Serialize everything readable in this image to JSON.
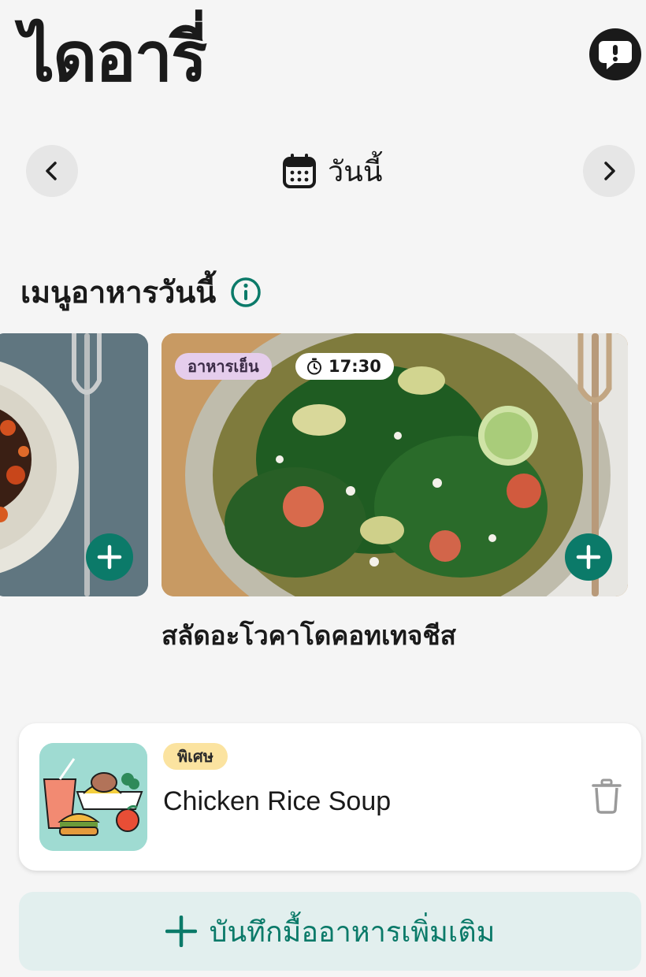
{
  "header": {
    "title": "ไดอารี่",
    "feedback_icon": "feedback-exclamation-icon"
  },
  "date_nav": {
    "label": "วันนี้",
    "prev_icon": "chevron-left-icon",
    "next_icon": "chevron-right-icon",
    "calendar_icon": "calendar-icon"
  },
  "menu": {
    "title": "เมนูอาหารวันนี้",
    "info_icon": "info-icon",
    "cards": [
      {
        "kind": "partial-previous-card"
      },
      {
        "meal_type": "อาหารเย็น",
        "time": "17:30",
        "name": "สลัดอะโวคาโดคอทเทจชีส"
      }
    ]
  },
  "entry": {
    "tag": "พิเศษ",
    "name": "Chicken Rice Soup",
    "delete_icon": "trash-icon"
  },
  "add_more": {
    "label": "บันทึกมื้ออาหารเพิ่มเติม",
    "icon": "plus-icon"
  },
  "colors": {
    "accent": "#0b7a69",
    "background": "#f5f5f5",
    "meal_badge": "#e5cdec",
    "special_tag": "#fbe3a0"
  }
}
